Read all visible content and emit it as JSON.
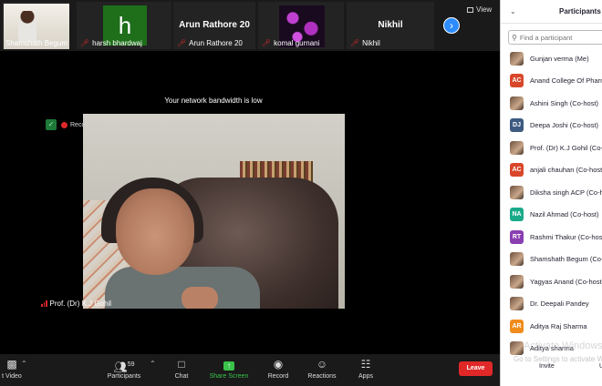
{
  "gallery": {
    "tiles": [
      {
        "name": "Shamshath Begum"
      },
      {
        "name": "harsh bhardwaj",
        "avatar_letter": "h"
      },
      {
        "name": "Arun Rathore 20",
        "display": "Arun Rathore 20"
      },
      {
        "name": "komal gurnani"
      },
      {
        "name": "Nikhil",
        "display": "Nikhil"
      }
    ],
    "view_label": "View"
  },
  "stage": {
    "bandwidth_notice": "Your network bandwidth is low",
    "recording_label": "Recording",
    "speaker_name": "Prof. (Dr) K.J Gohil"
  },
  "toolbar": {
    "video_label": "t Video",
    "participants_label": "Participants",
    "participants_count": "59",
    "chat_label": "Chat",
    "share_label": "Share Screen",
    "record_label": "Record",
    "reactions_label": "Reactions",
    "apps_label": "Apps",
    "leave_label": "Leave"
  },
  "panel": {
    "title": "Participants (59)",
    "search_placeholder": "Find a participant",
    "participants": [
      {
        "name": "Gunjan verma (Me)",
        "avatar": "",
        "color": "#6b3fa0"
      },
      {
        "name": "Anand College Of Pharm",
        "avatar": "AC",
        "color": "#d9472b"
      },
      {
        "name": "Ashini Singh (Co-host)",
        "avatar": "",
        "color": "#8a6a4a"
      },
      {
        "name": "Deepa Joshi (Co-host)",
        "avatar": "DJ",
        "color": "#3d5a80"
      },
      {
        "name": "Prof. (Dr) K.J Gohil (Co-",
        "avatar": "",
        "color": "#5a4a3a"
      },
      {
        "name": "anjali chauhan (Co-host)",
        "avatar": "AC",
        "color": "#d9472b"
      },
      {
        "name": "Diksha singh ACP (Co-h",
        "avatar": "",
        "color": "#7a7a6a"
      },
      {
        "name": "Nazil Ahmad (Co-host)",
        "avatar": "NA",
        "color": "#1aaa8a"
      },
      {
        "name": "Rashmi Thakur (Co-host)",
        "avatar": "RT",
        "color": "#8a3fb0"
      },
      {
        "name": "Shamshath Begum (Co-",
        "avatar": "",
        "color": "#6a4a30"
      },
      {
        "name": "Yagyas Anand (Co-host)",
        "avatar": "",
        "color": "#7a5a3a"
      },
      {
        "name": "Dr. Deepali Pandey",
        "avatar": "",
        "color": "#7a6040"
      },
      {
        "name": "Aditya Raj Sharma",
        "avatar": "AR",
        "color": "#f08c1c"
      },
      {
        "name": "Aditya sharma",
        "avatar": "",
        "color": "#5a5a5a"
      }
    ],
    "invite_label": "Invite",
    "u_label": "U"
  },
  "watermark": {
    "line1": "Activate Windows",
    "line2": "Go to Settings to activate Windows."
  }
}
